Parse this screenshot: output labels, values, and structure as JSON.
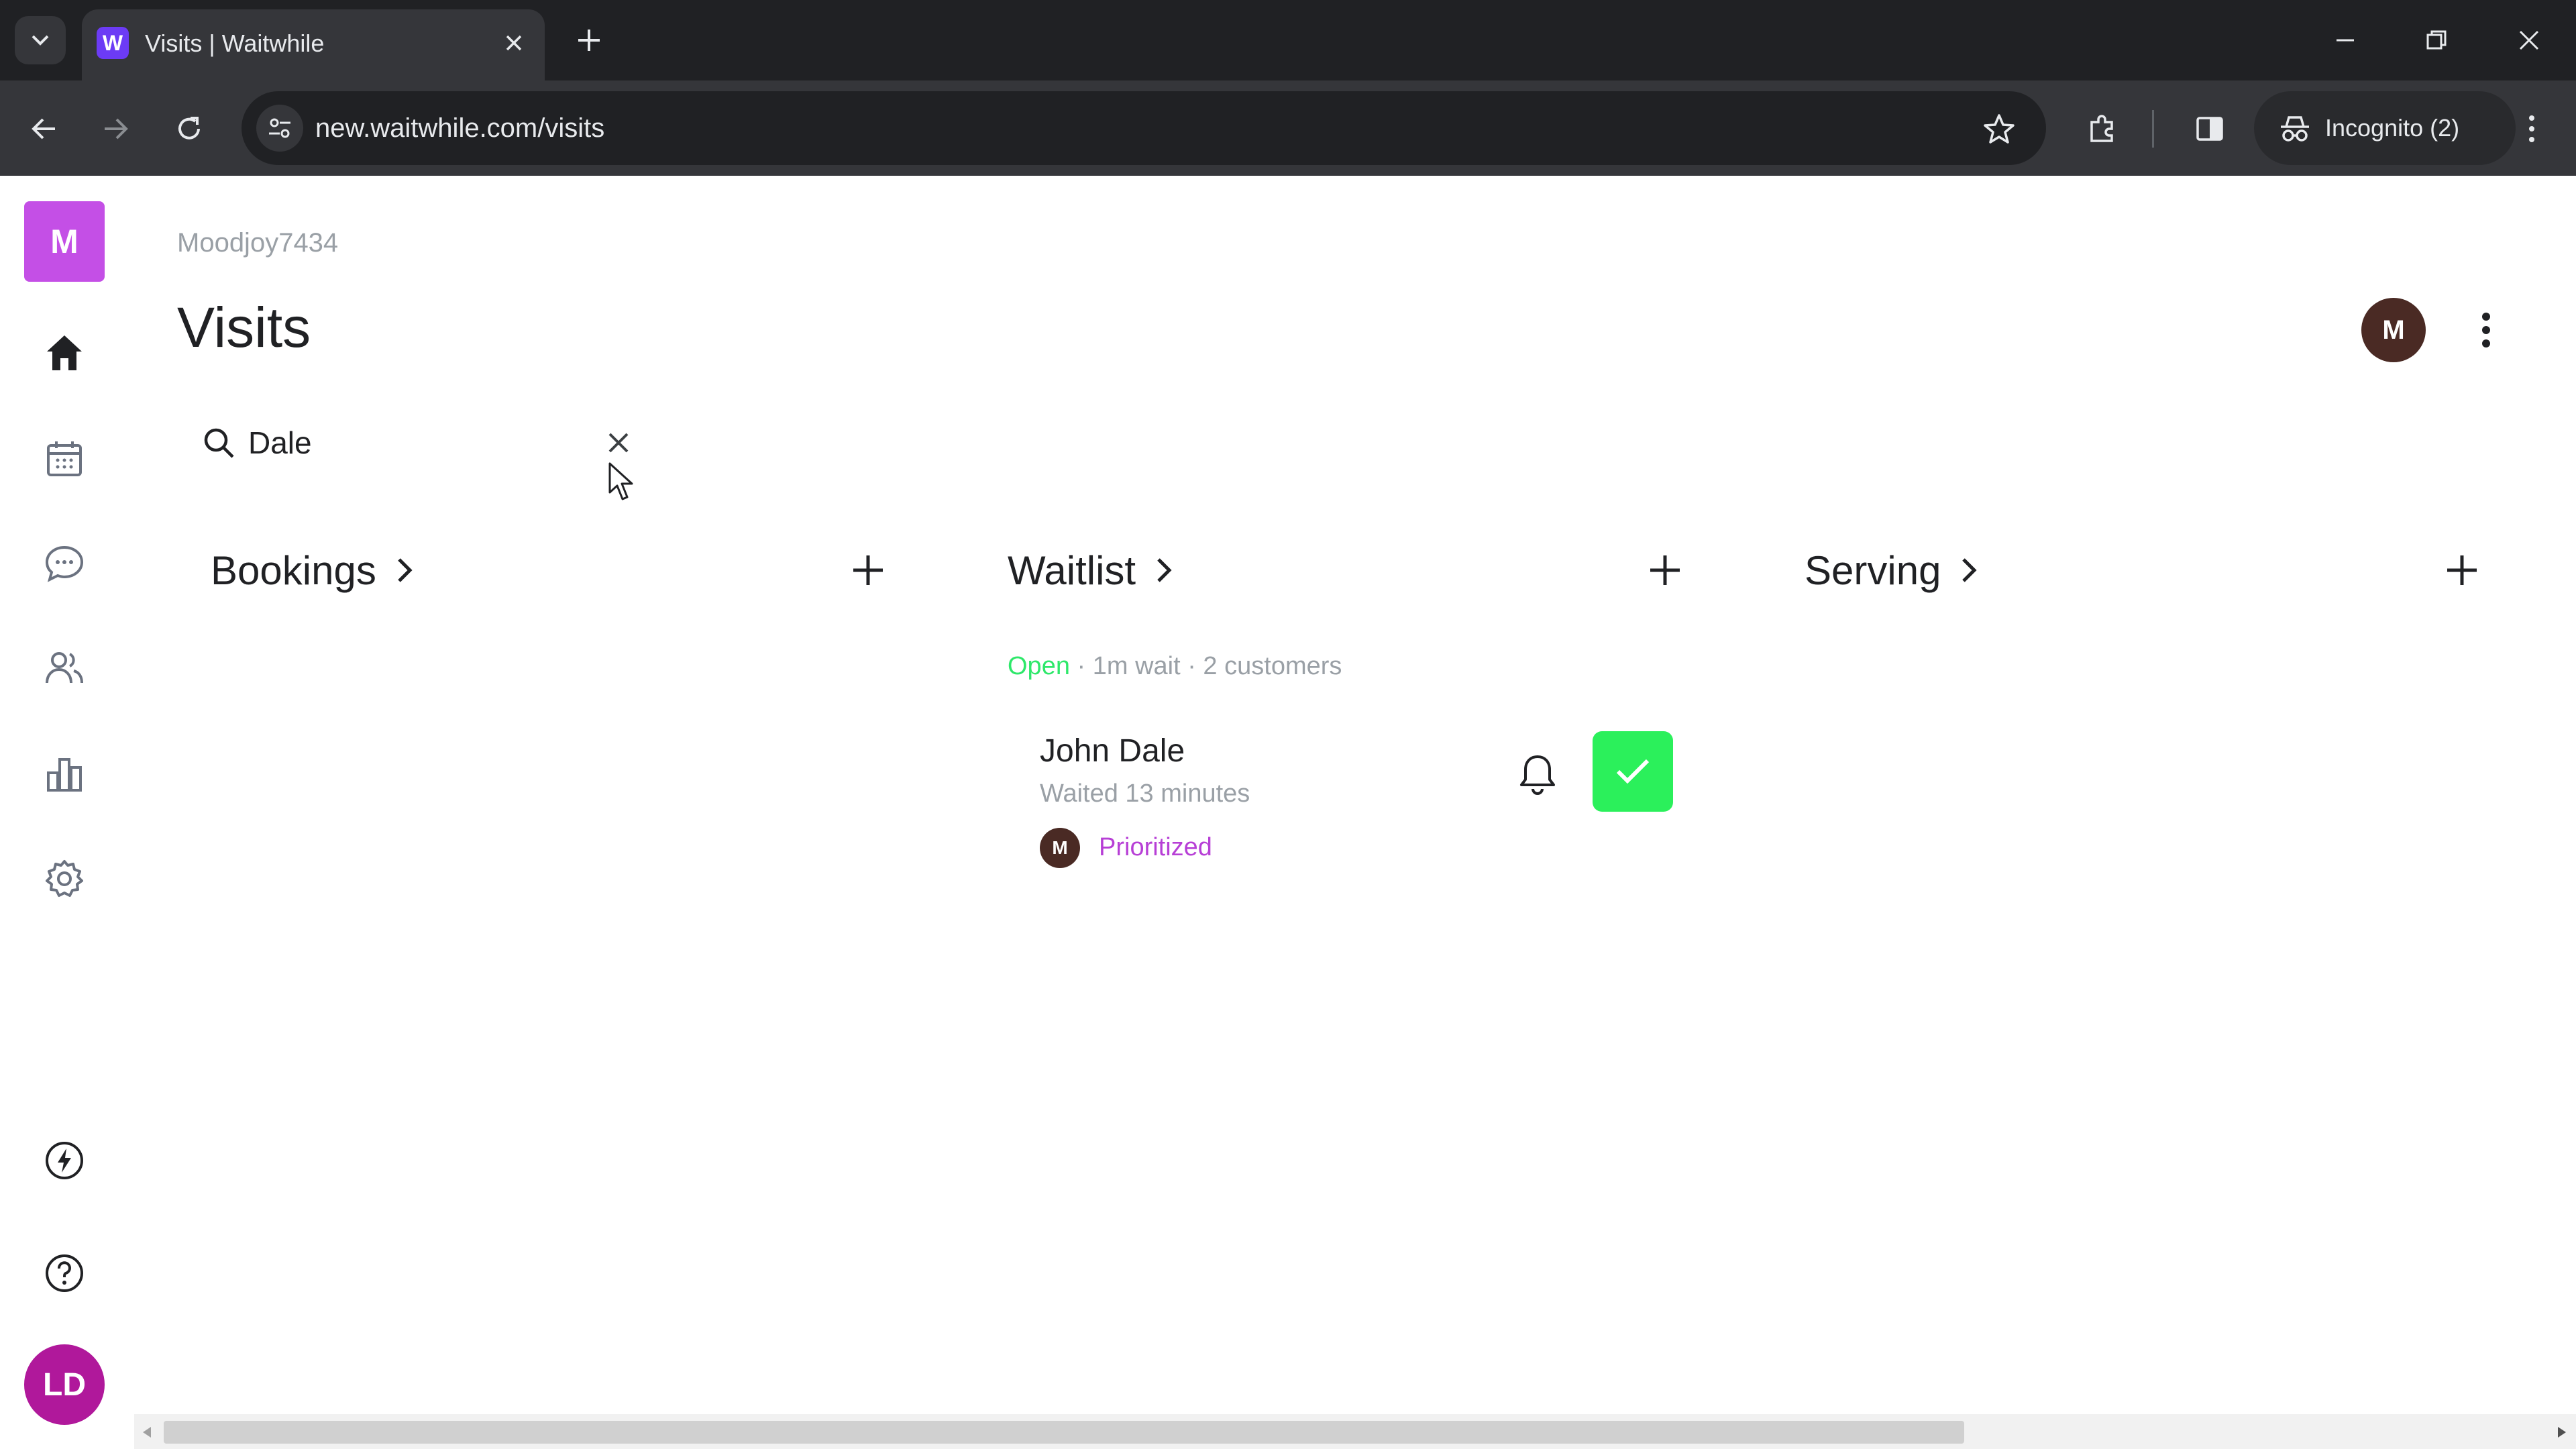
{
  "browser": {
    "tab_title": "Visits | Waitwhile",
    "favicon_letter": "W",
    "url": "new.waitwhile.com/visits",
    "incognito_label": "Incognito (2)"
  },
  "sidebar": {
    "org_initial": "M",
    "items": [
      {
        "name": "home"
      },
      {
        "name": "calendar"
      },
      {
        "name": "messages"
      },
      {
        "name": "customers"
      },
      {
        "name": "analytics"
      },
      {
        "name": "settings"
      }
    ],
    "user_initials": "LD"
  },
  "header": {
    "org_name": "Moodjoy7434",
    "title": "Visits",
    "avatar_initial": "M"
  },
  "search": {
    "value": "Dale",
    "placeholder": ""
  },
  "columns": {
    "bookings": {
      "title": "Bookings"
    },
    "waitlist": {
      "title": "Waitlist",
      "status_open": "Open",
      "status_rest": " · 1m wait · 2 customers"
    },
    "serving": {
      "title": "Serving"
    }
  },
  "visit": {
    "name": "John Dale",
    "wait_text": "Waited 13 minutes",
    "staff_initial": "M",
    "tag": "Prioritized"
  },
  "colors": {
    "accent": "#c44fe6",
    "serve_button": "#2bf05b",
    "open_status": "#2ee86a",
    "prioritized": "#b73fd6"
  }
}
